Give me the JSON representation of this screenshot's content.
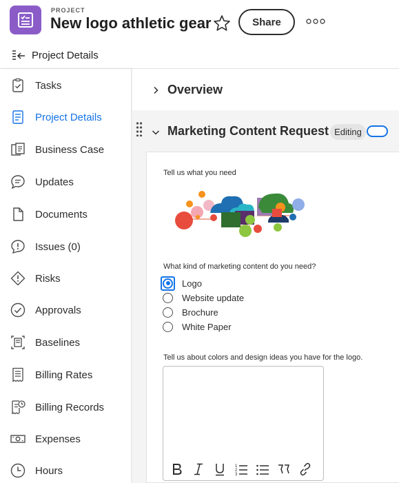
{
  "header": {
    "eyebrow": "PROJECT",
    "title": "New logo athletic gear",
    "share_label": "Share",
    "brand_color": "#8b5cc8"
  },
  "subheader": {
    "label": "Project Details"
  },
  "sidebar": {
    "active_color": "#1473e6",
    "items": [
      {
        "label": "Tasks",
        "icon": "tasks-icon"
      },
      {
        "label": "Project Details",
        "icon": "document-icon",
        "active": true
      },
      {
        "label": "Business Case",
        "icon": "business-case-icon"
      },
      {
        "label": "Updates",
        "icon": "chat-icon"
      },
      {
        "label": "Documents",
        "icon": "file-icon"
      },
      {
        "label": "Issues (0)",
        "icon": "issues-icon"
      },
      {
        "label": "Risks",
        "icon": "risk-icon"
      },
      {
        "label": "Approvals",
        "icon": "check-circle-icon"
      },
      {
        "label": "Baselines",
        "icon": "baseline-icon"
      },
      {
        "label": "Billing Rates",
        "icon": "billing-rates-icon"
      },
      {
        "label": "Billing Records",
        "icon": "billing-records-icon"
      },
      {
        "label": "Expenses",
        "icon": "money-icon"
      },
      {
        "label": "Hours",
        "icon": "clock-icon"
      }
    ]
  },
  "main": {
    "overview_title": "Overview",
    "section_title": "Marketing Content Request",
    "editing_badge": "Editing",
    "form": {
      "intro_label": "Tell us what you need",
      "question_label": "What kind of marketing content do you need?",
      "options": [
        "Logo",
        "Website update",
        "Brochure",
        "White Paper"
      ],
      "selected_option": "Logo",
      "colors_label": "Tell us about colors and design ideas you have for the logo.",
      "colors_value": "",
      "toolbar": [
        "bold",
        "italic",
        "underline",
        "numbered-list",
        "bulleted-list",
        "quote",
        "link"
      ]
    }
  }
}
